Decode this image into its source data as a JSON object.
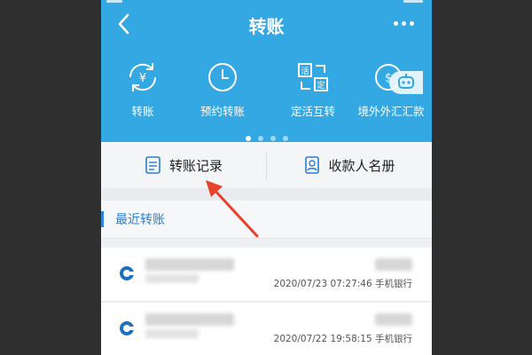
{
  "header": {
    "title": "转账",
    "bg_color": "#33a8e2",
    "back_icon": "chevron-left-icon",
    "more_icon": "more-dots-icon"
  },
  "features": [
    {
      "label": "转账",
      "icon": "transfer-yen-icon"
    },
    {
      "label": "预约转账",
      "icon": "clock-icon"
    },
    {
      "label": "定活互转",
      "icon": "fixed-current-swap-icon"
    },
    {
      "label": "境外外汇汇款",
      "icon": "globe-remit-icon"
    }
  ],
  "pager": {
    "total": 4,
    "active": 0
  },
  "tabs": [
    {
      "label": "转账记录",
      "icon": "document-list-icon"
    },
    {
      "label": "收款人名册",
      "icon": "address-book-icon"
    }
  ],
  "recent": {
    "heading": "最近转账",
    "accent_color": "#2c86d8",
    "items": [
      {
        "timestamp": "2020/07/23 07:27:46 手机银行",
        "logo": "bank-logo-icon"
      },
      {
        "timestamp": "2020/07/22 19:58:15 手机银行",
        "logo": "bank-logo-icon"
      }
    ]
  },
  "annotation": {
    "type": "red-arrow",
    "points_to": "转账记录",
    "color": "#e8412c"
  }
}
